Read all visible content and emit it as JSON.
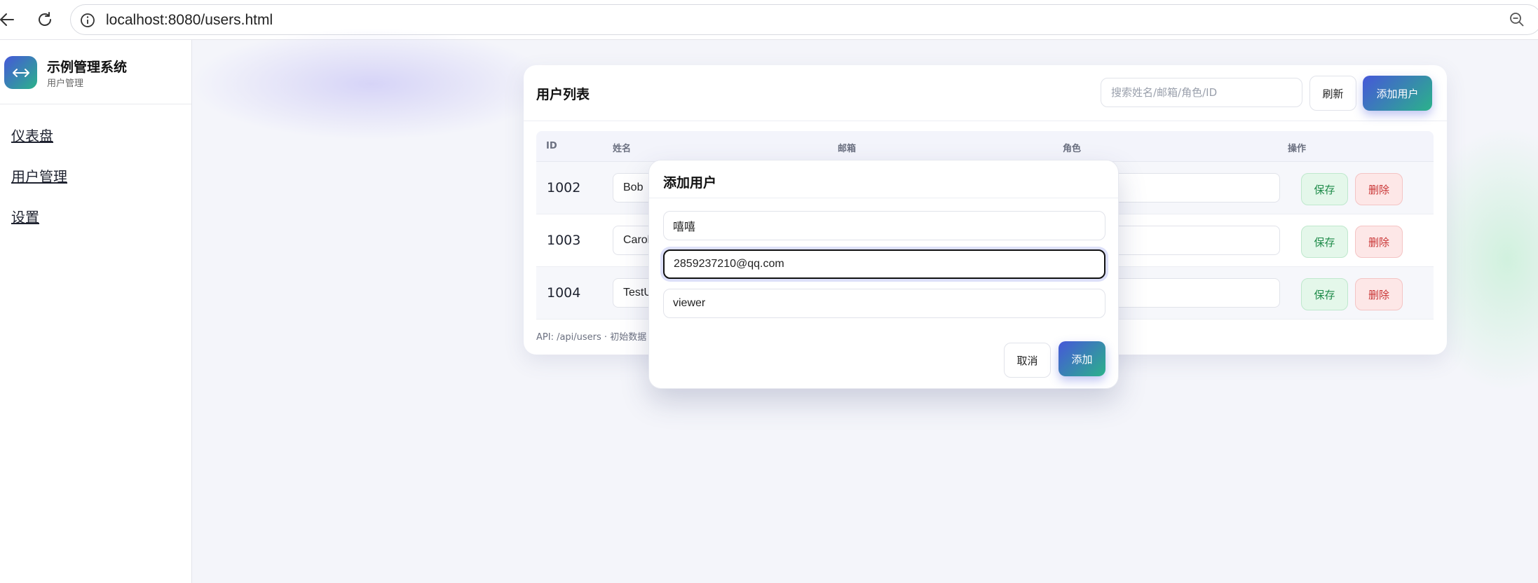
{
  "browser": {
    "url": "localhost:8080/users.html",
    "icons": [
      "back-arrow-icon",
      "reload-icon",
      "info-icon",
      "zoom-out-icon"
    ]
  },
  "colors": {
    "accent_start": "#4657d9",
    "accent_end": "#2bb28a",
    "save_bg": "#e4f7ea",
    "delete_bg": "#fde7e7"
  },
  "sidebar": {
    "brand_title": "示例管理系统",
    "brand_subtitle": "用户管理",
    "logo_icon": "swap-arrows-icon",
    "items": [
      {
        "label": "仪表盘"
      },
      {
        "label": "用户管理"
      },
      {
        "label": "设置"
      }
    ]
  },
  "main": {
    "title": "用户列表",
    "search_placeholder": "搜索姓名/邮箱/角色/ID",
    "search_value": "",
    "refresh_label": "刷新",
    "add_label": "添加用户",
    "columns": [
      "ID",
      "姓名",
      "邮箱",
      "角色",
      "操作"
    ],
    "rows": [
      {
        "id": "1002",
        "name": "Bob",
        "save_label": "保存",
        "delete_label": "删除"
      },
      {
        "id": "1003",
        "name": "Carol",
        "save_label": "保存",
        "delete_label": "删除"
      },
      {
        "id": "1004",
        "name": "TestU",
        "save_label": "保存",
        "delete_label": "删除"
      }
    ],
    "footnote": "API: /api/users · 初始数据"
  },
  "modal": {
    "title": "添加用户",
    "name_value": "嘻嘻",
    "email_value": "2859237210@qq.com",
    "role_value": "viewer",
    "cancel_label": "取消",
    "confirm_label": "添加"
  }
}
